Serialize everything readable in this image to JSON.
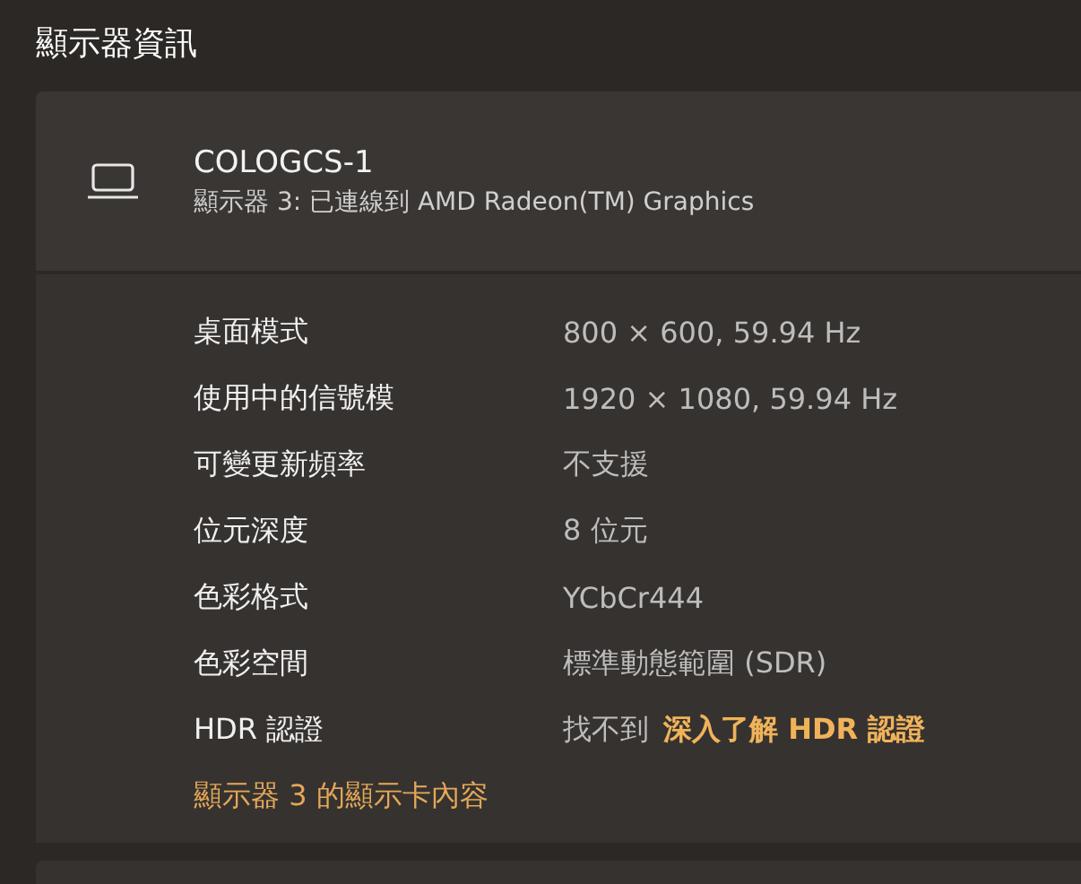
{
  "page": {
    "title": "顯示器資訊"
  },
  "display": {
    "name": "COLOGCS-1",
    "subtitle": "顯示器 3: 已連線到 AMD Radeon(TM) Graphics"
  },
  "details": [
    {
      "label": "桌面模式",
      "value": "800 × 600, 59.94 Hz"
    },
    {
      "label": "使用中的信號模",
      "value": "1920 × 1080, 59.94 Hz"
    },
    {
      "label": "可變更新頻率",
      "value": "不支援"
    },
    {
      "label": "位元深度",
      "value": "8 位元"
    },
    {
      "label": "色彩格式",
      "value": "YCbCr444"
    },
    {
      "label": "色彩空間",
      "value": "標準動態範圍 (SDR)"
    },
    {
      "label": "HDR 認證",
      "value": "找不到",
      "link": "深入了解 HDR 認證"
    }
  ],
  "adapter_link": "顯示器 3 的顯示卡內容"
}
